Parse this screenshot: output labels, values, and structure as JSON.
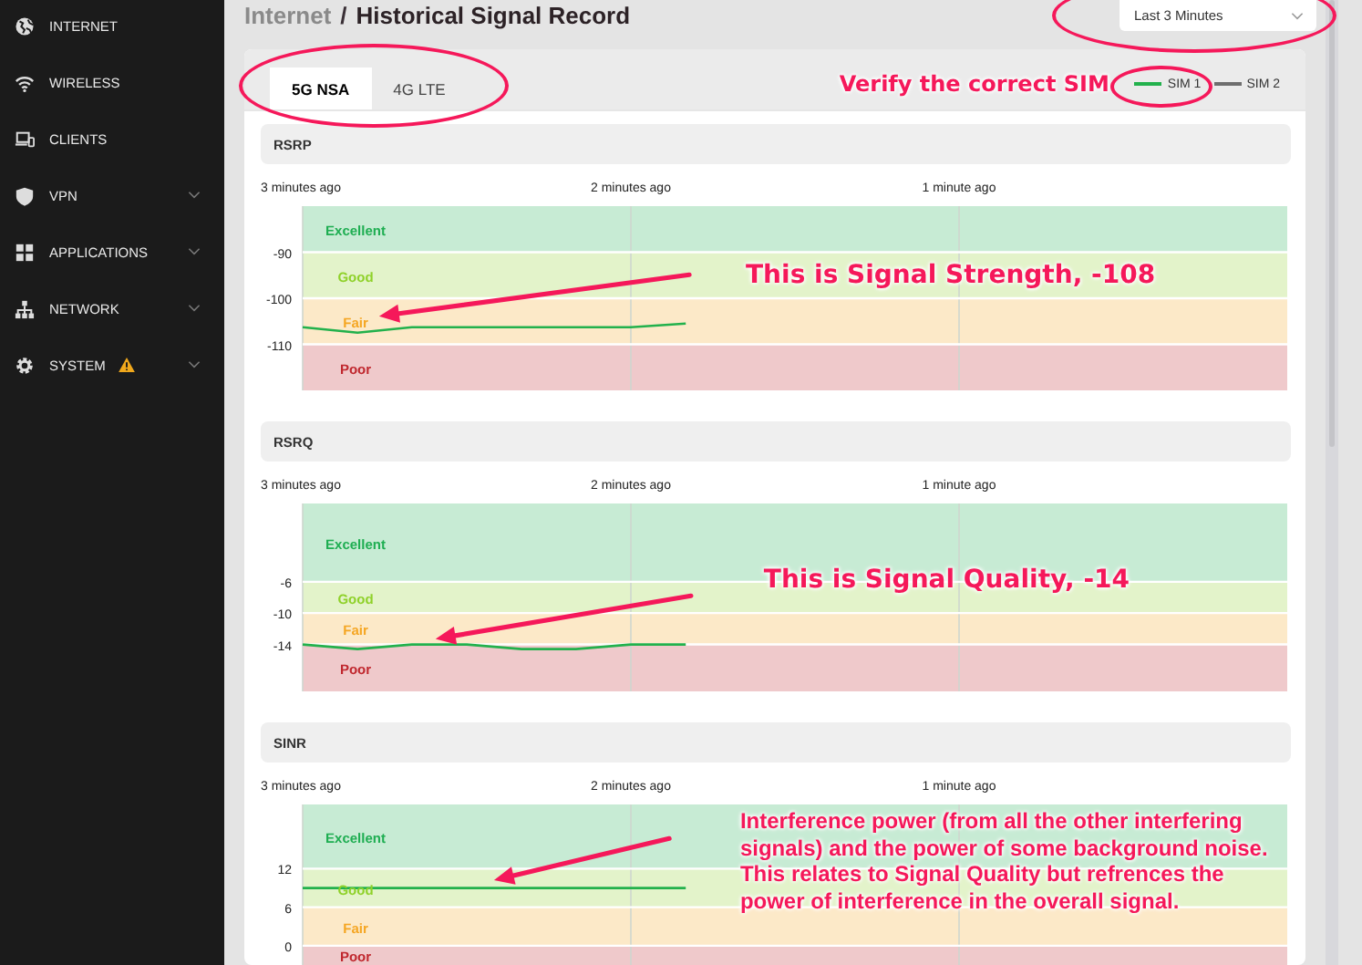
{
  "sidebar": {
    "items": [
      {
        "label": "INTERNET",
        "expandable": false,
        "warning": false
      },
      {
        "label": "WIRELESS",
        "expandable": false,
        "warning": false
      },
      {
        "label": "CLIENTS",
        "expandable": false,
        "warning": false
      },
      {
        "label": "VPN",
        "expandable": true,
        "warning": false
      },
      {
        "label": "APPLICATIONS",
        "expandable": true,
        "warning": false
      },
      {
        "label": "NETWORK",
        "expandable": true,
        "warning": false
      },
      {
        "label": "SYSTEM",
        "expandable": true,
        "warning": true
      }
    ]
  },
  "breadcrumb": {
    "parent": "Internet",
    "separator": "/",
    "current": "Historical Signal Record"
  },
  "range_select": {
    "value": "Last 3 Minutes"
  },
  "tabs": [
    {
      "label": "5G NSA",
      "selected": true
    },
    {
      "label": "4G LTE",
      "selected": false
    }
  ],
  "header_callout": "Verify the correct SIM",
  "legend": [
    {
      "name": "SIM 1",
      "color": "#22b14c"
    },
    {
      "name": "SIM 2",
      "color": "#6e6e6e"
    }
  ],
  "sections": [
    {
      "title": "RSRP",
      "chart_data": {
        "type": "line",
        "x": [
          3,
          2.833,
          2.667,
          2.5,
          2.333,
          2.167,
          2,
          1.833
        ],
        "series": [
          {
            "color": "#22b14c",
            "values": [
              -106.3,
              -107.5,
              -106.3,
              -106.3,
              -106.3,
              -106.3,
              -106.3,
              -105.5
            ]
          }
        ],
        "xlim": [
          3,
          0
        ],
        "ylim": [
          -120,
          -80
        ],
        "xticks": [
          {
            "value": 3,
            "label": "3 minutes ago"
          },
          {
            "value": 2,
            "label": "2 minutes ago"
          },
          {
            "value": 1,
            "label": "1 minute ago"
          }
        ],
        "yticks": [
          -110,
          -100,
          -90
        ],
        "grid": true,
        "bands": [
          {
            "axis": "y",
            "label": "Excellent",
            "from": -90,
            "to": -80,
            "color": "#1fae52"
          },
          {
            "axis": "y",
            "label": "Good",
            "from": -100,
            "to": -90,
            "color": "#8fd12a"
          },
          {
            "axis": "y",
            "label": "Fair",
            "from": -110,
            "to": -100,
            "color": "#f5a623"
          },
          {
            "axis": "y",
            "label": "Poor",
            "from": -120,
            "to": -110,
            "color": "#c0282f"
          }
        ],
        "annotations": [
          "This is Signal Strength, -108"
        ]
      }
    },
    {
      "title": "RSRQ",
      "chart_data": {
        "type": "line",
        "x": [
          3,
          2.833,
          2.667,
          2.5,
          2.333,
          2.167,
          2,
          1.833
        ],
        "series": [
          {
            "color": "#22b14c",
            "values": [
              -14,
              -14.6,
              -14,
              -14,
              -14.6,
              -14.6,
              -14,
              -14
            ]
          }
        ],
        "xlim": [
          3,
          0
        ],
        "ylim": [
          -20,
          4
        ],
        "xticks": [
          {
            "value": 3,
            "label": "3 minutes ago"
          },
          {
            "value": 2,
            "label": "2 minutes ago"
          },
          {
            "value": 1,
            "label": "1 minute ago"
          }
        ],
        "yticks": [
          -14,
          -10,
          -6
        ],
        "grid": true,
        "bands": [
          {
            "axis": "y",
            "label": "Excellent",
            "from": -6,
            "to": 4,
            "color": "#1fae52"
          },
          {
            "axis": "y",
            "label": "Good",
            "from": -10,
            "to": -6,
            "color": "#8fd12a"
          },
          {
            "axis": "y",
            "label": "Fair",
            "from": -14,
            "to": -10,
            "color": "#f5a623"
          },
          {
            "axis": "y",
            "label": "Poor",
            "from": -20,
            "to": -14,
            "color": "#c0282f"
          }
        ],
        "annotations": [
          "This is Signal Quality, -14"
        ]
      }
    },
    {
      "title": "SINR",
      "chart_data": {
        "type": "line",
        "x": [
          3,
          2.833,
          2.667,
          2.5,
          2.333,
          2.167,
          2,
          1.833
        ],
        "series": [
          {
            "color": "#22b14c",
            "values": [
              9,
              9,
              9,
              9,
              9,
              9,
              9,
              9
            ]
          }
        ],
        "xlim": [
          3,
          0
        ],
        "ylim": [
          -3,
          22
        ],
        "xticks": [
          {
            "value": 3,
            "label": "3 minutes ago"
          },
          {
            "value": 2,
            "label": "2 minutes ago"
          },
          {
            "value": 1,
            "label": "1 minute ago"
          }
        ],
        "yticks": [
          0,
          6,
          12
        ],
        "grid": true,
        "bands": [
          {
            "axis": "y",
            "label": "Excellent",
            "from": 12,
            "to": 22,
            "color": "#1fae52"
          },
          {
            "axis": "y",
            "label": "Good",
            "from": 6,
            "to": 12,
            "color": "#8fd12a"
          },
          {
            "axis": "y",
            "label": "Fair",
            "from": 0,
            "to": 6,
            "color": "#f5a623"
          },
          {
            "axis": "y",
            "label": "Poor",
            "from": -3,
            "to": 0,
            "color": "#c0282f"
          }
        ],
        "annotations": [
          "Interference power (from all the other interfering signals) and the power of some background noise.  This relates to Signal Quality but refrences the power of interference in the overall signal."
        ]
      }
    }
  ]
}
